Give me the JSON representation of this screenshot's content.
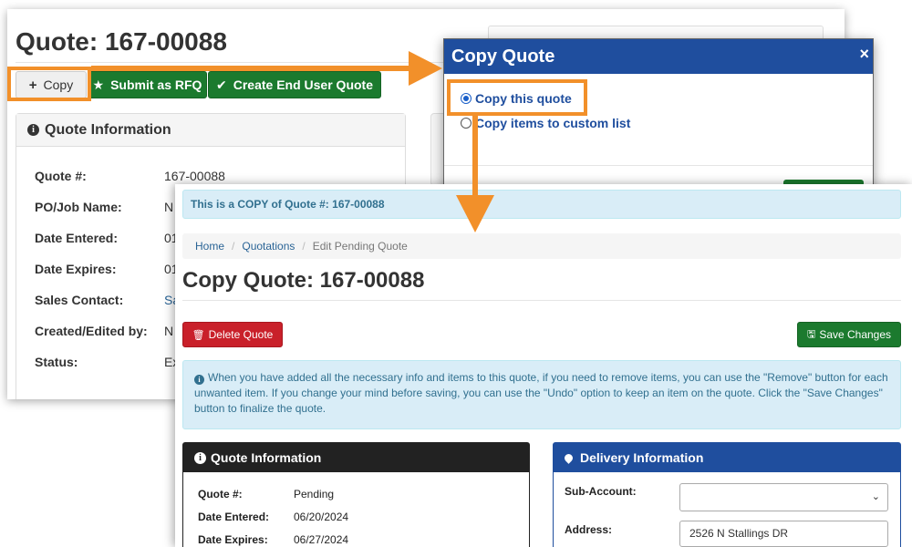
{
  "quote_page": {
    "title": "Quote: 167-00088",
    "buttons": {
      "copy": "Copy",
      "submit_rfq": "Submit as RFQ",
      "create_end_user": "Create End User Quote"
    },
    "panel_title": "Quote Information",
    "fields": [
      {
        "label": "Quote #:",
        "value": "167-00088"
      },
      {
        "label": "PO/Job Name:",
        "value": "N"
      },
      {
        "label": "Date Entered:",
        "value": "01"
      },
      {
        "label": "Date Expires:",
        "value": "01"
      },
      {
        "label": "Sales Contact:",
        "value": "Sa"
      },
      {
        "label": "Created/Edited by:",
        "value": "N"
      },
      {
        "label": "Status:",
        "value": "Ex"
      }
    ]
  },
  "copy_modal": {
    "title": "Copy Quote",
    "close": "×",
    "options": [
      "Copy this quote",
      "Copy items to custom list"
    ],
    "selected": "Copy this quote"
  },
  "copy_page": {
    "banner": "This is a COPY of Quote #: 167-00088",
    "breadcrumb": [
      "Home",
      "Quotations",
      "Edit Pending Quote"
    ],
    "title": "Copy Quote: 167-00088",
    "delete_label": "Delete Quote",
    "save_label": "Save Changes",
    "info_text": "When you have added all the necessary info and items to this quote, if you need to remove items, you can use the \"Remove\" button for each unwanted item. If you change your mind before saving, you can use the \"Undo\" option to keep an item on the quote. Click the \"Save Changes\" button to finalize the quote.",
    "quote_info": {
      "title": "Quote Information",
      "rows": [
        {
          "label": "Quote #:",
          "value": "Pending"
        },
        {
          "label": "Date Entered:",
          "value": "06/20/2024"
        },
        {
          "label": "Date Expires:",
          "value": "06/27/2024"
        }
      ]
    },
    "delivery_info": {
      "title": "Delivery Information",
      "sub_account_label": "Sub-Account:",
      "sub_account_value": "",
      "address_label": "Address:",
      "address_value": "2526 N Stallings DR"
    }
  },
  "colors": {
    "callout": "#f2902a",
    "primary_blue": "#1f4e9e",
    "success_green": "#1b7a2e",
    "danger_red": "#c9202a",
    "info_bg": "#d9edf7"
  }
}
